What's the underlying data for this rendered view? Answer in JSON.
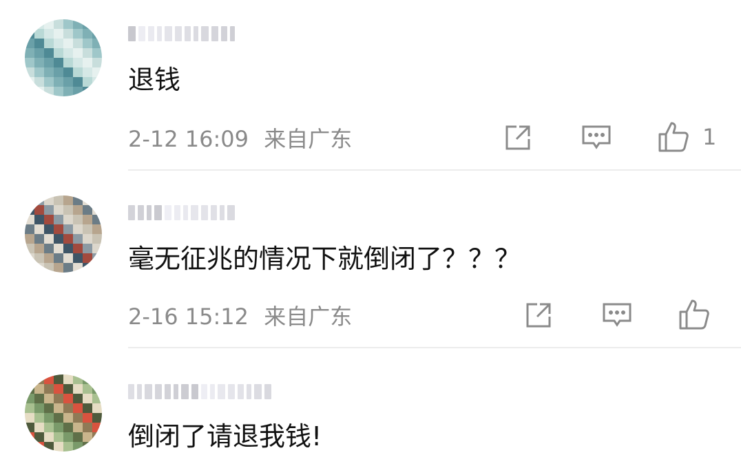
{
  "comments": [
    {
      "text": "退钱",
      "date": "2-12 16:09",
      "location": "来自广东",
      "like_count": "1",
      "avatar_icon": "blurred-avatar",
      "avatar_colors": [
        "#b9d9d6",
        "#7fb0b5",
        "#e6f1ef",
        "#4f8a95",
        "#9fc7c9",
        "#d5e8e6",
        "#6aa0a8",
        "#c8dedc"
      ]
    },
    {
      "text": "毫无征兆的情况下就倒闭了？？？",
      "date": "2-16 15:12",
      "location": "来自广东",
      "like_count": "",
      "avatar_icon": "blurred-avatar",
      "avatar_colors": [
        "#c9c3b4",
        "#a24a3e",
        "#6b7c86",
        "#dcd7cc",
        "#3e5566",
        "#b7a58e",
        "#8c9aa3",
        "#e3ddd2"
      ]
    },
    {
      "text": "倒闭了请退我钱!",
      "date": "",
      "location": "",
      "like_count": "",
      "avatar_icon": "blurred-avatar",
      "avatar_colors": [
        "#7a9a6a",
        "#4e5a3c",
        "#c9b58c",
        "#a8c090",
        "#d9533f",
        "#5f6f48",
        "#e6ddc4",
        "#8f7a56"
      ]
    }
  ],
  "icons": {
    "share": "share-icon",
    "reply": "comment-icon",
    "like": "thumbs-up-icon"
  }
}
